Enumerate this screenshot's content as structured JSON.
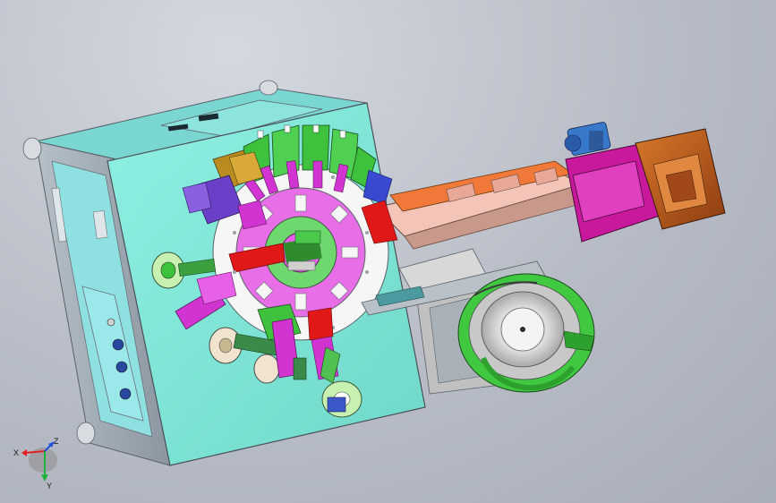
{
  "viewport": {
    "background_top": "#d4d8e0",
    "background_bottom": "#a8adb8"
  },
  "triad": {
    "x_label": "X",
    "y_label": "Y",
    "z_label": "Z",
    "x_color": "#e02020",
    "y_color": "#20b040",
    "z_color": "#2050e0"
  },
  "colors": {
    "frame_panel": "#7de8d8",
    "frame_side": "#8fdcd6",
    "frame_edge": "#9aa0a8",
    "rotary_disc": "#f4f4f4",
    "rotary_hub": "#e45ce4",
    "station_green": "#3ec23e",
    "station_magenta": "#d030d0",
    "station_purple": "#6a40c8",
    "station_red": "#e02020",
    "conveyor": "#f4c4b8",
    "conveyor_orange": "#f07838",
    "hopper_magenta": "#c8189c",
    "hopper_brown": "#b85820",
    "motor_blue": "#3878c8",
    "bowl_green": "#40c840",
    "bowl_grey": "#c8c8c8"
  }
}
